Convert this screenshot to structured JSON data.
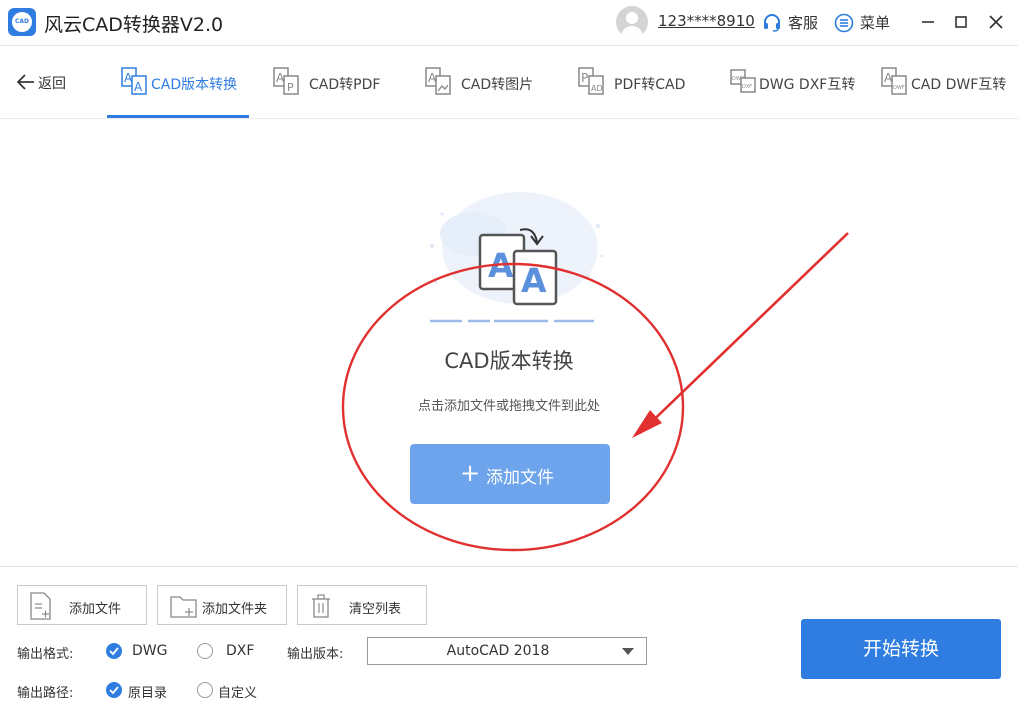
{
  "app": {
    "title": "风云CAD转换器V2.0",
    "logo_text": "CAD"
  },
  "header": {
    "username": "123****8910",
    "service_label": "客服",
    "menu_label": "菜单"
  },
  "nav": {
    "back_label": "返回",
    "tabs": [
      {
        "label": "CAD版本转换",
        "active": true,
        "icon": "version-convert-icon"
      },
      {
        "label": "CAD转PDF",
        "active": false,
        "icon": "cad-to-pdf-icon"
      },
      {
        "label": "CAD转图片",
        "active": false,
        "icon": "cad-to-image-icon"
      },
      {
        "label": "PDF转CAD",
        "active": false,
        "icon": "pdf-to-cad-icon"
      },
      {
        "label": "DWG DXF互转",
        "active": false,
        "icon": "dwg-dxf-icon"
      },
      {
        "label": "CAD DWF互转",
        "active": false,
        "icon": "cad-dwf-icon"
      }
    ]
  },
  "main": {
    "title": "CAD版本转换",
    "subtitle": "点击添加文件或拖拽文件到此处",
    "add_button_label": "添加文件",
    "illustration_letters": [
      "A",
      "A"
    ]
  },
  "toolbar": {
    "add_file_label": "添加文件",
    "add_folder_label": "添加文件夹",
    "clear_list_label": "清空列表"
  },
  "options": {
    "format_label": "输出格式:",
    "formats": [
      {
        "label": "DWG",
        "selected": true
      },
      {
        "label": "DXF",
        "selected": false
      }
    ],
    "version_label": "输出版本:",
    "version_value": "AutoCAD 2018",
    "path_label": "输出路径:",
    "paths": [
      {
        "label": "原目录",
        "selected": true
      },
      {
        "label": "自定义",
        "selected": false
      }
    ]
  },
  "start_button_label": "开始转换",
  "colors": {
    "accent": "#2f7de1",
    "annotation": "#e03030",
    "add_button": "#6da4ec"
  }
}
